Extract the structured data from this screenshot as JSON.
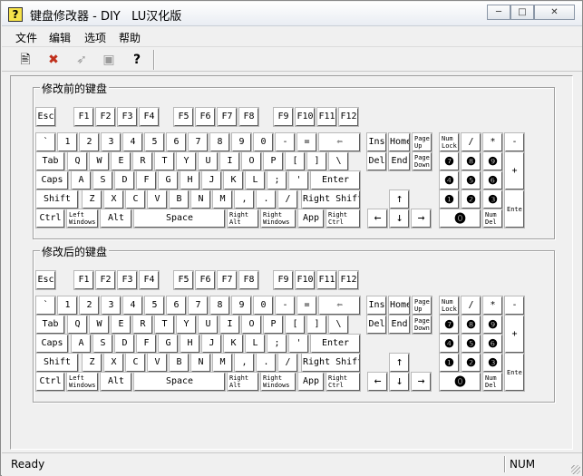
{
  "window": {
    "title": "键盘修改器 - DIY   LU汉化版",
    "icon": "question-mark-icon",
    "controls": {
      "minimize": "─",
      "maximize": "□",
      "close": "✕"
    }
  },
  "menu": [
    "文件",
    "编辑",
    "选项",
    "帮助"
  ],
  "toolbar": {
    "icons": [
      "open-keyboard-icon",
      "delete-keyboard-icon",
      "apply-icon",
      "preview-icon",
      "help-icon"
    ],
    "glyphs": [
      "🖹",
      "✖",
      "➶",
      "▣",
      "?"
    ]
  },
  "groups": {
    "before": "修改前的键盘",
    "after": "修改后的键盘"
  },
  "keys": {
    "esc": "Esc",
    "f": [
      "F1",
      "F2",
      "F3",
      "F4",
      "F5",
      "F6",
      "F7",
      "F8",
      "F9",
      "F10",
      "F11",
      "F12"
    ],
    "num_row": [
      "`",
      "1",
      "2",
      "3",
      "4",
      "5",
      "6",
      "7",
      "8",
      "9",
      "0",
      "-",
      "=",
      "⇦"
    ],
    "tab": "Tab",
    "q_row": [
      "Q",
      "W",
      "E",
      "R",
      "T",
      "Y",
      "U",
      "I",
      "O",
      "P",
      "[",
      "]",
      "\\"
    ],
    "caps": "Caps",
    "a_row": [
      "A",
      "S",
      "D",
      "F",
      "G",
      "H",
      "J",
      "K",
      "L",
      ";",
      "'"
    ],
    "enter": "Enter",
    "shift": "Shift",
    "z_row": [
      "Z",
      "X",
      "C",
      "V",
      "B",
      "N",
      "M",
      ",",
      ".",
      "/"
    ],
    "rshift": "Right Shift",
    "ctrl": "Ctrl",
    "lwin": "Left Windows",
    "alt": "Alt",
    "space": "Space",
    "ralt": "Right Alt",
    "rwin": "Right Windows",
    "app": "App",
    "rctrl": "Right Ctrl",
    "ins": "Ins",
    "home": "Home",
    "pgup": "Page Up",
    "del": "Del",
    "end": "End",
    "pgdn": "Page Down",
    "up": "↑",
    "left": "←",
    "down": "↓",
    "right": "→",
    "numlock": "Num Lock",
    "kp_div": "/",
    "kp_mul": "*",
    "kp_sub": "-",
    "kp_add": "+",
    "kp_enter": "Enter",
    "kp7": "❼",
    "kp8": "❽",
    "kp9": "❾",
    "kp4": "❹",
    "kp5": "❺",
    "kp6": "❻",
    "kp1": "❶",
    "kp2": "❷",
    "kp3": "❸",
    "kp0": "⓿",
    "kp_del": "Num Del"
  },
  "status": {
    "text": "Ready",
    "num": "NUM"
  }
}
